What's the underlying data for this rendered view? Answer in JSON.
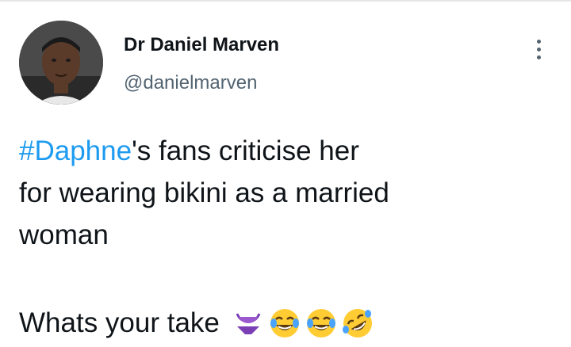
{
  "author": {
    "display_name": "Dr Daniel Marven",
    "handle": "@danielmarven"
  },
  "tweet": {
    "hashtag": "#Daphne",
    "line1_rest": "'s fans criticise her",
    "line2": "for wearing bikini as a married",
    "line3": "woman",
    "take_text": "Whats your take",
    "emojis": [
      "bikini-emoji",
      "face-with-tears-of-joy-emoji",
      "face-with-tears-of-joy-emoji",
      "rolling-on-the-floor-laughing-emoji"
    ]
  },
  "colors": {
    "hashtag": "#1d9bf0",
    "handle": "#536471",
    "text": "#0f1419"
  },
  "icons": {
    "more": "more-vertical-icon"
  }
}
